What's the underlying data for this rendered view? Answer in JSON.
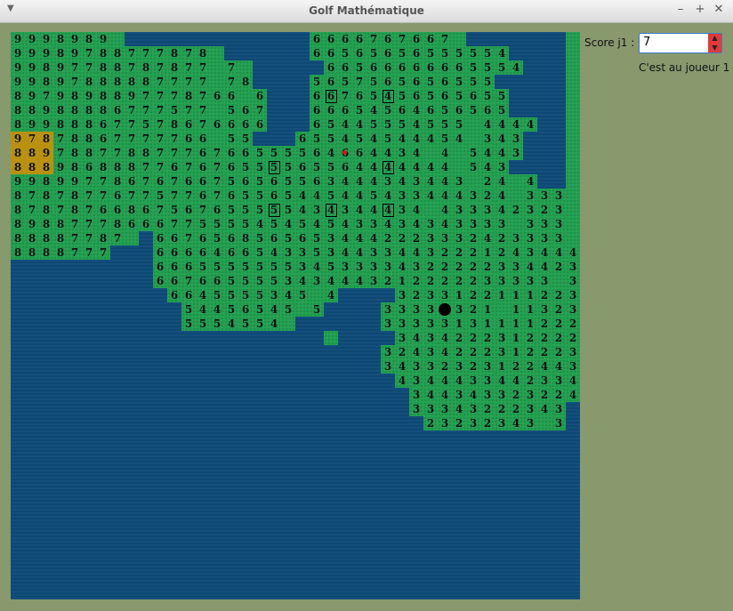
{
  "window": {
    "title": "Golf Mathématique",
    "menu_icon": "dropdown-arrow-icon",
    "controls": [
      "–",
      "+",
      "✕"
    ]
  },
  "sidebar": {
    "score_label": "Score j1 :",
    "score_value": "7",
    "turn_text": "C'est au joueur 1"
  },
  "colors": {
    "sea": "#0e4b79",
    "grass": "#24a354",
    "sand": "#b8920f",
    "background": "#88996d"
  },
  "board": {
    "rows": [
      "9998989 .............6666767667 ....... ",
      "99989788777878 ......66565656555554.... ",
      "99897788787877 7 .....66566666665554... ",
      "99897888887777 78....5657565656555..... ",
      "8979898897778766 6...66765456565655.... ",
      "88988886777577 567...66654564656565.... ",
      "899888677578676666...65445554555 4444.. ",
      "97878867777766 55...655454544454 343... ",
      "88978877887776766555564664434 4 5443... ",
      "8889868887767676555565564444444 543.... ",
      "99899778676766756565563444343443 24 4.. ",
      "87878776775776765565445445433444324 333 ",
      "87878766867567655555434344434 433342323 ",
      "89887778666775555454545433434343333 333 ",
      "88887787 .66765685656534442223332423333 ",
      "8888777...666646654335344334432221243444",
      "..........666555555534533334322222334423",
      "..........6676655553434443212222233333 3",
      "...........6645555345 4....32331221112234",
      "............54456545 5....33332321 113233",
      "............5554554 ......33333131111222",
      "...................... ....343422231222232",
      "..........................32434222312223",
      "..........................34332323122443",
      "...........................4344433442334",
      "............................344343323224",
      "............................33343222343.",
      ".............................23232343 3."
    ],
    "sand_cells": [
      [
        7,
        0
      ],
      [
        7,
        1
      ],
      [
        7,
        2
      ],
      [
        8,
        0
      ],
      [
        8,
        1
      ],
      [
        8,
        2
      ],
      [
        9,
        0
      ],
      [
        9,
        1
      ],
      [
        9,
        2
      ]
    ],
    "boxed_cells": [
      [
        4,
        18
      ],
      [
        4,
        22
      ],
      [
        4,
        26
      ],
      [
        9,
        18
      ],
      [
        9,
        26
      ],
      [
        12,
        18
      ],
      [
        12,
        22
      ],
      [
        12,
        26
      ]
    ],
    "hole": {
      "row": 19,
      "col": 30
    },
    "ball": {
      "row": 8,
      "col": 23
    }
  }
}
